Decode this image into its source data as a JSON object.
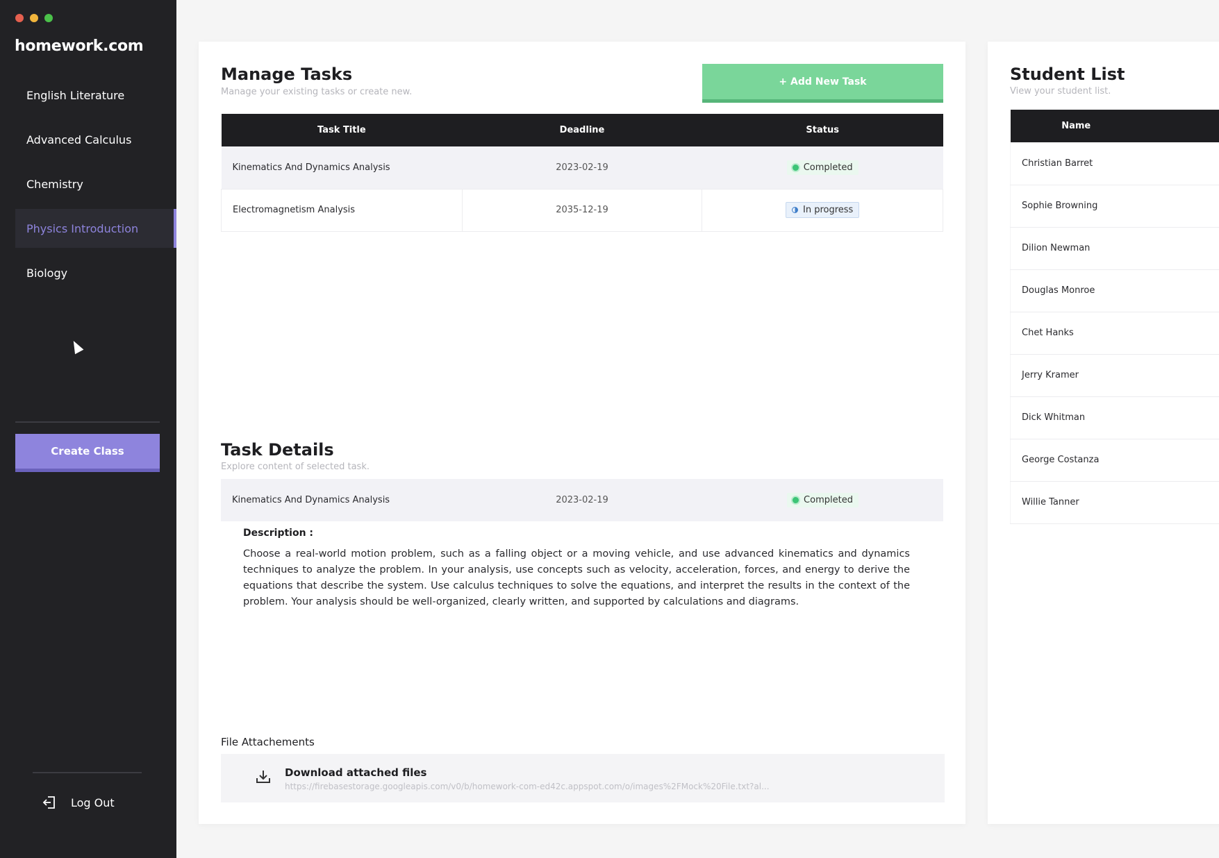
{
  "brand": "homework.com",
  "window_controls": {
    "close": "#e5604f",
    "minimize": "#f1b53c",
    "maximize": "#4bc14a"
  },
  "accent": "#8e84dd",
  "sidebar": {
    "items": [
      {
        "label": "English Literature"
      },
      {
        "label": "Advanced Calculus"
      },
      {
        "label": "Chemistry"
      },
      {
        "label": "Physics Introduction",
        "active": true
      },
      {
        "label": "Biology"
      }
    ],
    "create_label": "Create Class",
    "logout_label": "Log Out"
  },
  "tasks": {
    "title": "Manage Tasks",
    "subtitle": "Manage your existing tasks or create new.",
    "add_label": "+ Add New Task",
    "columns": [
      "Task Title",
      "Deadline",
      "Status"
    ],
    "rows": [
      {
        "title": "Kinematics And Dynamics Analysis",
        "deadline": "2023-02-19",
        "status": "Completed"
      },
      {
        "title": "Electromagnetism Analysis",
        "deadline": "2035-12-19",
        "status": "In progress"
      }
    ]
  },
  "details": {
    "title": "Task Details",
    "subtitle": "Explore content of selected task.",
    "task_title": "Kinematics And Dynamics Analysis",
    "deadline": "2023-02-19",
    "status": "Completed",
    "description_label": "Description :",
    "description": "Choose a real-world motion problem, such as a falling object or a moving vehicle, and use advanced kinematics and dynamics techniques to analyze the problem. In your analysis, use concepts such as velocity, acceleration, forces, and energy to derive the equations that describe the system. Use calculus techniques to solve the equations, and interpret the results in the context of the problem. Your analysis should be well-organized, clearly written, and supported by calculations and diagrams.",
    "attachments_label": "File Attachements",
    "download_label": "Download attached files",
    "download_url": "https://firebasestorage.googleapis.com/v0/b/homework-com-ed42c.appspot.com/o/images%2FMock%20File.txt?al..."
  },
  "students": {
    "title": "Student List",
    "subtitle": "View your student list.",
    "column": "Name",
    "names": [
      "Christian Barret",
      "Sophie Browning",
      "Dilion Newman",
      "Douglas Monroe",
      "Chet Hanks",
      "Jerry Kramer",
      "Dick Whitman",
      "George Costanza",
      "Willie Tanner"
    ]
  }
}
